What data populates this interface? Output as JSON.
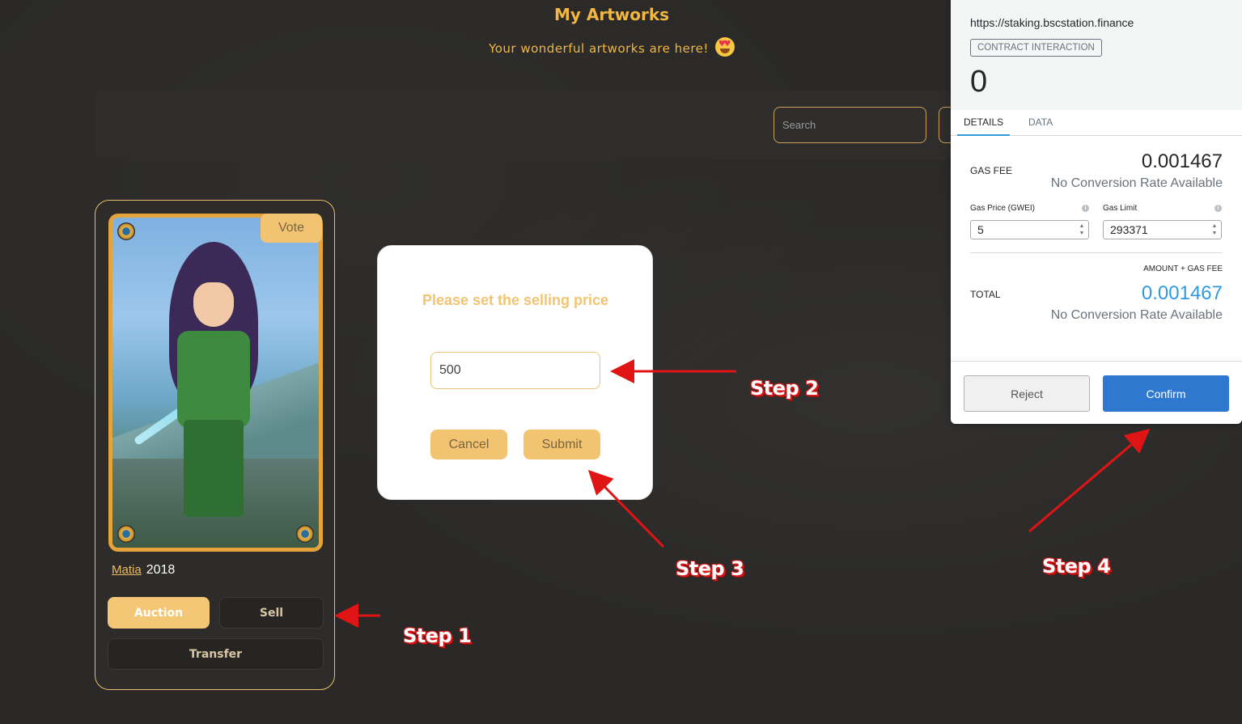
{
  "page": {
    "title": "My Artworks",
    "subtitle": "Your wonderful artworks are here!",
    "search_placeholder": "Search"
  },
  "card": {
    "vote_label": "Vote",
    "artist": "Matia",
    "year": "2018",
    "auction_label": "Auction",
    "sell_label": "Sell",
    "transfer_label": "Transfer"
  },
  "price_modal": {
    "title": "Please set the selling price",
    "price_value": "500",
    "cancel_label": "Cancel",
    "submit_label": "Submit"
  },
  "metamask": {
    "origin": "https://staking.bscstation.finance",
    "badge": "CONTRACT INTERACTION",
    "amount": "0",
    "tabs": [
      "DETAILS",
      "DATA"
    ],
    "gas_fee_label": "GAS FEE",
    "gas_fee_value": "0.001467",
    "no_conversion": "No Conversion Rate Available",
    "gas_price_label": "Gas Price (GWEI)",
    "gas_price_value": "5",
    "gas_limit_label": "Gas Limit",
    "gas_limit_value": "293371",
    "amount_gas_fee_label": "AMOUNT + GAS FEE",
    "total_label": "TOTAL",
    "total_value": "0.001467",
    "reject_label": "Reject",
    "confirm_label": "Confirm"
  },
  "annotations": {
    "step1": "Step 1",
    "step2": "Step 2",
    "step3": "Step 3",
    "step4": "Step 4",
    "arrow_color": "#e01414"
  },
  "colors": {
    "accent": "#f3b741",
    "button_gold": "#f2c371",
    "metamask_blue": "#2f78d0",
    "background": "#2a2927"
  }
}
